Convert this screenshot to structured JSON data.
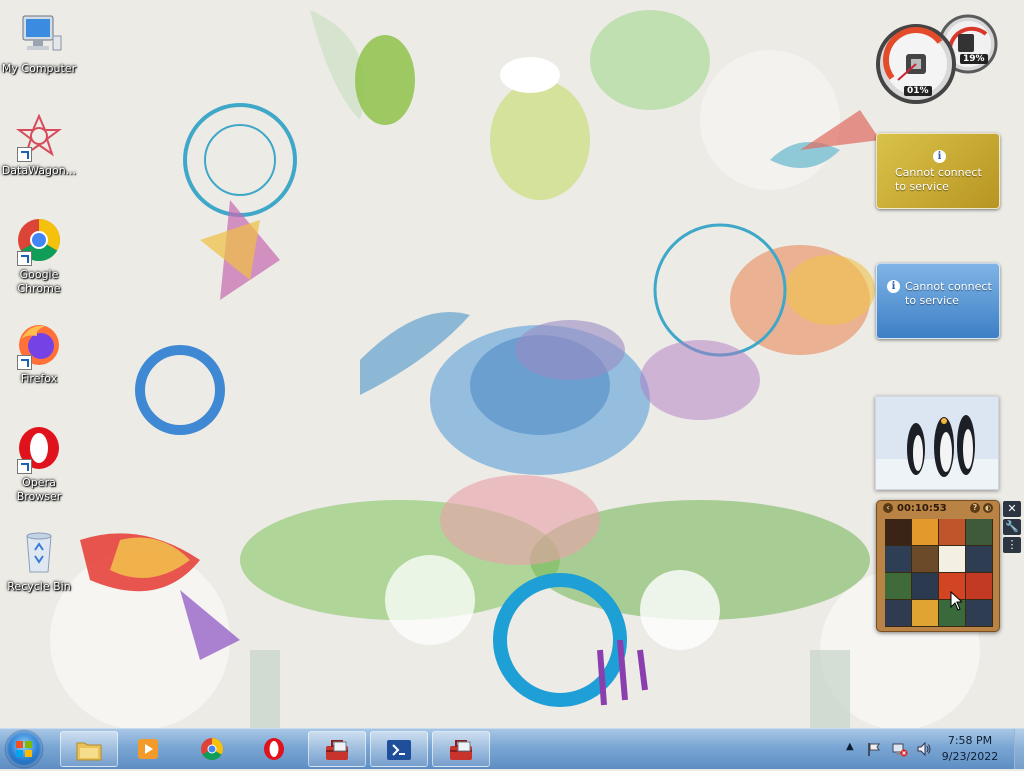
{
  "desktop": {
    "icons": [
      {
        "label": "My Computer",
        "icon": "computer-icon"
      },
      {
        "label": "DataWagon...",
        "icon": "datawagon-icon"
      },
      {
        "label": "Google Chrome",
        "icon": "chrome-icon"
      },
      {
        "label": "Firefox",
        "icon": "firefox-icon"
      },
      {
        "label": "Opera Browser",
        "icon": "opera-icon"
      },
      {
        "label": "Recycle Bin",
        "icon": "recycle-bin-icon"
      }
    ]
  },
  "gadgets": {
    "cpu_meter": {
      "cpu_percent": "01%",
      "memory_percent": "19%",
      "cpu_value": 1,
      "memory_value": 19
    },
    "weather_1": {
      "message": "Cannot connect to service",
      "style": "gold-map"
    },
    "weather_2": {
      "message": "Cannot connect to service",
      "style": "blue"
    },
    "slideshow": {
      "subject": "penguins"
    },
    "puzzle": {
      "timer": "00:10:53"
    }
  },
  "taskbar": {
    "buttons": [
      {
        "name": "windows-explorer",
        "icon": "folder-icon",
        "active": true
      },
      {
        "name": "media-player",
        "icon": "media-player-icon",
        "active": false
      },
      {
        "name": "google-chrome",
        "icon": "chrome-icon",
        "active": false
      },
      {
        "name": "opera",
        "icon": "opera-icon",
        "active": false
      },
      {
        "name": "toolbox-1",
        "icon": "toolbox-icon",
        "active": true
      },
      {
        "name": "powershell",
        "icon": "powershell-icon",
        "active": true
      },
      {
        "name": "toolbox-2",
        "icon": "toolbox-icon",
        "active": true
      }
    ],
    "clock": {
      "time": "7:58 PM",
      "date": "9/23/2022"
    }
  },
  "colors": {
    "taskbar": "#7aa6d4",
    "weather_gold": "#c9a928",
    "weather_blue": "#4f92d3",
    "puzzle_wood": "#b98345"
  }
}
